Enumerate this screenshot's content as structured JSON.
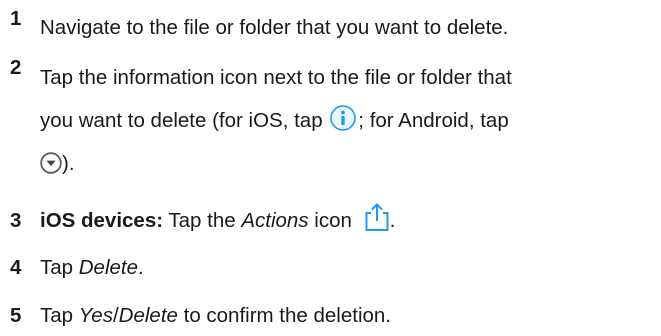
{
  "steps": [
    {
      "num": "1",
      "text": "Navigate to the file or folder that you want to delete."
    },
    {
      "num": "2",
      "line1": "Tap the information icon next to the file or folder that",
      "line2_before": "you want to delete (for iOS, tap ",
      "line2_after": "; for Android, tap",
      "line3_after": ").",
      "icons": [
        "info-icon",
        "dropdown-circle-icon"
      ]
    },
    {
      "num": "3",
      "bold": "iOS devices:",
      "text_before": " Tap the ",
      "italic": "Actions",
      "text_after": " icon ",
      "end": ".",
      "icon": "share-icon"
    },
    {
      "num": "4",
      "text_before": "Tap ",
      "italic": "Delete",
      "end": "."
    },
    {
      "num": "5",
      "text_before": "Tap ",
      "italic1": "Yes",
      "slash": "/",
      "italic2": "Delete",
      "text_after": " to confirm the deletion."
    }
  ],
  "colors": {
    "text": "#1a1a1a",
    "ios_blue": "#1e9bf0",
    "android_gray": "#5a5a5a"
  }
}
